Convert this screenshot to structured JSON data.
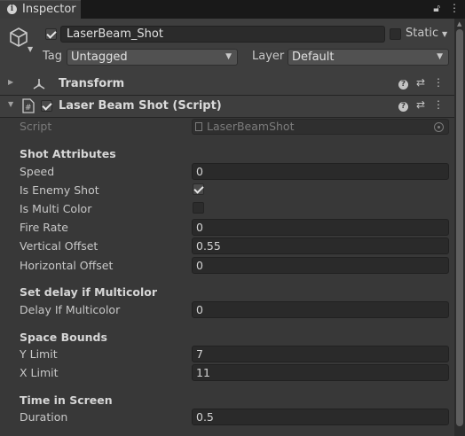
{
  "tab": {
    "label": "Inspector",
    "icon": "info-icon"
  },
  "tab_icons": [
    "lock-icon",
    "kebab-menu-icon"
  ],
  "gameobject": {
    "active": true,
    "name": "LaserBeam_Shot",
    "static_label": "Static",
    "static": false,
    "tag_label": "Tag",
    "tag_value": "Untagged",
    "layer_label": "Layer",
    "layer_value": "Default"
  },
  "components": {
    "transform": {
      "title": "Transform"
    },
    "script": {
      "title": "Laser Beam Shot (Script)",
      "enabled": true
    }
  },
  "script_field": {
    "label": "Script",
    "value": "LaserBeamShot"
  },
  "sections": {
    "shot_attributes": "Shot Attributes",
    "set_delay": "Set delay if Multicolor",
    "space_bounds": "Space Bounds",
    "time_in_screen": "Time in Screen"
  },
  "fields": {
    "speed": {
      "label": "Speed",
      "value": "0"
    },
    "is_enemy_shot": {
      "label": "Is Enemy Shot",
      "checked": true
    },
    "is_multi_color": {
      "label": "Is Multi Color",
      "checked": false
    },
    "fire_rate": {
      "label": "Fire Rate",
      "value": "0"
    },
    "vertical_offset": {
      "label": "Vertical Offset",
      "value": "0.55"
    },
    "horizontal_offset": {
      "label": "Horizontal Offset",
      "value": "0"
    },
    "delay_if_multicolor": {
      "label": "Delay If Multicolor",
      "value": "0"
    },
    "y_limit": {
      "label": "Y Limit",
      "value": "7"
    },
    "x_limit": {
      "label": "X Limit",
      "value": "11"
    },
    "duration": {
      "label": "Duration",
      "value": "0.5"
    }
  },
  "colors": {
    "background": "#383838",
    "header_background": "#3e3e3e",
    "field_background": "#2a2a2a",
    "text": "#c8c8c8"
  }
}
